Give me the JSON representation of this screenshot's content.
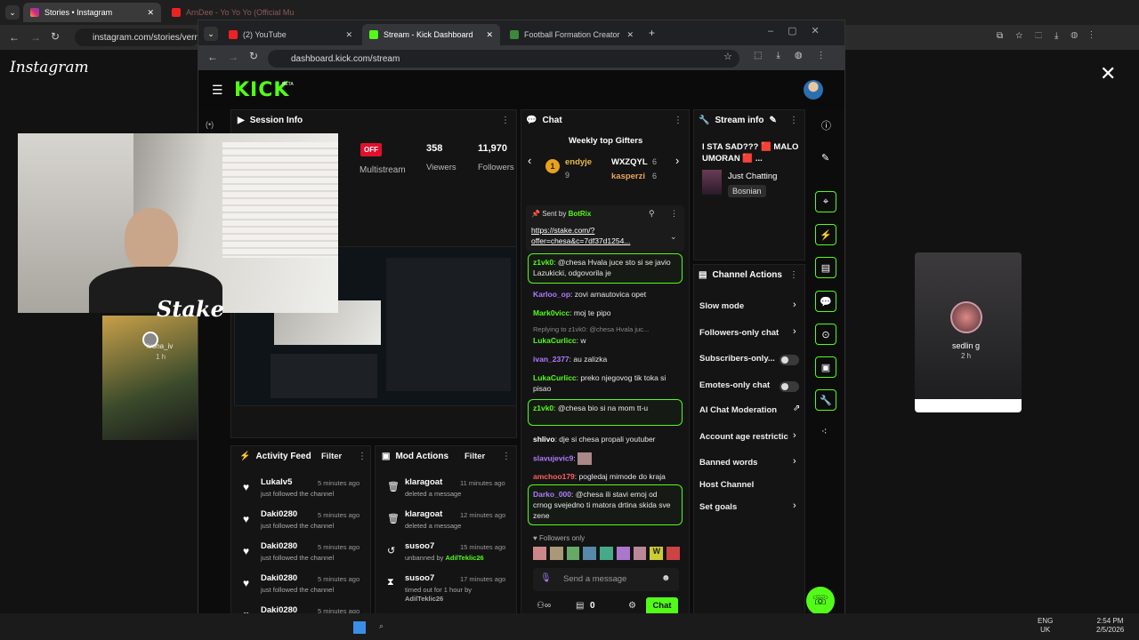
{
  "outer_browser": {
    "tabs": [
      {
        "title": "Stories • Instagram",
        "active": true
      },
      {
        "title": "ArnDee - Yo Yo Yo (Official Mu",
        "active": false
      }
    ],
    "url": "instagram.com/stories/verne"
  },
  "instagram": {
    "logo": "Instagram",
    "close_icon": "close-icon",
    "left_story_user": "ivona_iv",
    "left_story_time": "1 h",
    "right_story_user": "sedlin g",
    "right_story_time": "2 h"
  },
  "kick_window": {
    "tabs": [
      {
        "title": "(2) YouTube",
        "active": false
      },
      {
        "title": "Stream - Kick Dashboard",
        "active": true
      },
      {
        "title": "Football Formation Creator",
        "active": false
      }
    ],
    "url": "dashboard.kick.com/stream",
    "logo": "KICK",
    "logo_badge": "BETA"
  },
  "session_info": {
    "title": "Session Info",
    "status_badge": "OFF",
    "multistream_label": "Multistream",
    "viewers_value": "358",
    "viewers_label": "Viewers",
    "followers_value": "11,970",
    "followers_label": "Followers"
  },
  "webcam": {
    "overlay_text": "Stake"
  },
  "chat": {
    "title": "Chat",
    "gifters_title": "Weekly top Gifters",
    "gifters": [
      {
        "rank": "1",
        "name": "endyje",
        "count": "9"
      },
      {
        "name": "WXZQYL",
        "count": "6"
      },
      {
        "name": "kasperzi",
        "count": "6"
      }
    ],
    "pinned_sent_by": "Sent by",
    "pinned_user": "BotRix",
    "pinned_link": "https://stake.com/?offer=chesa&c=7df37d1254...",
    "messages": [
      {
        "user": "z1vk0",
        "text": "@chesa Hvala juce sto si se javio Lazukicki, odgovorila je"
      },
      {
        "user": "Karloo_op",
        "text": "zovi arnautovica opet"
      },
      {
        "user": "Mark0vicc",
        "text": "moj te pipo"
      },
      {
        "reply": "Replying to z1vk0: @chesa Hvala juc...",
        "user": "LukaCurlicc",
        "text": "w"
      },
      {
        "user": "ivan_2377",
        "text": "au zalizka"
      },
      {
        "user": "LukaCurlicc",
        "text": "preko njegovog tik toka si pisao"
      },
      {
        "user": "z1vk0",
        "text": "@chesa bio si na mom tt-u"
      },
      {
        "user": "shlivo",
        "text": "dje si chesa propali youtuber"
      },
      {
        "user": "slavujevic9",
        "text": ""
      },
      {
        "user": "amchoo179",
        "text": "pogledaj mimode do kraja"
      },
      {
        "user": "Darko_000",
        "text": "@chesa ili stavi emoj od crnog svejedno ti matora drtina skida sve zene"
      }
    ],
    "followers_only_label": "Followers only",
    "input_placeholder": "Send a message",
    "counter": "0",
    "send_button": "Chat"
  },
  "stream_info": {
    "title": "Stream info",
    "stream_title": "I STA SAD??? 🟥 MALO UMORAN 🟥 ...",
    "category": "Just Chatting",
    "language": "Bosnian"
  },
  "channel_actions": {
    "title": "Channel Actions",
    "items": [
      {
        "label": "Slow mode",
        "control": "chevron"
      },
      {
        "label": "Followers-only chat",
        "control": "chevron"
      },
      {
        "label": "Subscribers-only...",
        "control": "toggle"
      },
      {
        "label": "Emotes-only chat",
        "control": "toggle"
      },
      {
        "label": "AI Chat Moderation",
        "control": "external"
      },
      {
        "label": "Account age restrictic",
        "control": "chevron"
      },
      {
        "label": "Banned words",
        "control": "chevron"
      },
      {
        "label": "Host Channel",
        "control": "none"
      },
      {
        "label": "Set goals",
        "control": "chevron"
      }
    ]
  },
  "activity_feed": {
    "title": "Activity Feed",
    "filter_label": "Filter",
    "rows": [
      {
        "user": "Lukalv5",
        "action": "just followed the channel",
        "time": "5 minutes ago"
      },
      {
        "user": "Daki0280",
        "action": "just followed the channel",
        "time": "5 minutes ago"
      },
      {
        "user": "Daki0280",
        "action": "just followed the channel",
        "time": "5 minutes ago"
      },
      {
        "user": "Daki0280",
        "action": "just followed the channel",
        "time": "5 minutes ago"
      },
      {
        "user": "Daki0280",
        "action": "",
        "time": "5 minutes ago"
      }
    ]
  },
  "mod_actions": {
    "title": "Mod Actions",
    "filter_label": "Filter",
    "rows": [
      {
        "user": "klaragoat",
        "action": "deleted a message",
        "time": "11 minutes ago",
        "icon": "trash-icon"
      },
      {
        "user": "klaragoat",
        "action": "deleted a message",
        "time": "12 minutes ago",
        "icon": "trash-icon"
      },
      {
        "user": "susoo7",
        "action": "unbanned by",
        "by": "AdilTeklic26",
        "time": "15 minutes ago",
        "icon": "undo-icon"
      },
      {
        "user": "susoo7",
        "action": "timed out for 1 hour by",
        "by": "AdilTeklic26",
        "time": "17 minutes ago",
        "icon": "hourglass-icon"
      }
    ]
  },
  "taskbar": {
    "lang": "ENG",
    "region": "UK",
    "time": "2:54 PM",
    "date": "2/5/2026"
  },
  "colors": {
    "kick_green": "#53fc18",
    "offline_red": "#e0102d",
    "panel_bg": "#141414"
  }
}
